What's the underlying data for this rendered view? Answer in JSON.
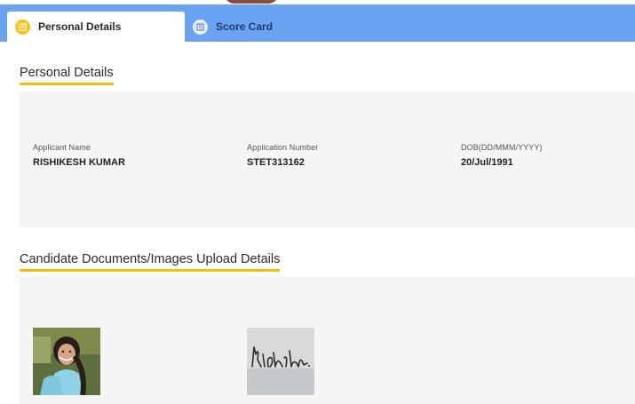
{
  "tabs": [
    {
      "label": "Personal Details",
      "icon": "id-card-icon",
      "active": true
    },
    {
      "label": "Score Card",
      "icon": "scorecard-icon",
      "active": false
    }
  ],
  "personal_section": {
    "title": "Personal Details",
    "fields": [
      {
        "label": "Applicant Name",
        "value": "RISHIKESH KUMAR"
      },
      {
        "label": "Application Number",
        "value": "STET313162"
      },
      {
        "label": "DOB(DD/MMM/YYYY)",
        "value": "20/Jul/1991"
      }
    ]
  },
  "documents_section": {
    "title": "Candidate Documents/Images Upload Details",
    "images": [
      "candidate-photo",
      "candidate-signature"
    ]
  },
  "colors": {
    "tab_bar": "#6aa3f2",
    "accent_underline": "#f0bf12",
    "panel_bg": "#f5f5f5",
    "active_icon": "#f3c51d"
  }
}
